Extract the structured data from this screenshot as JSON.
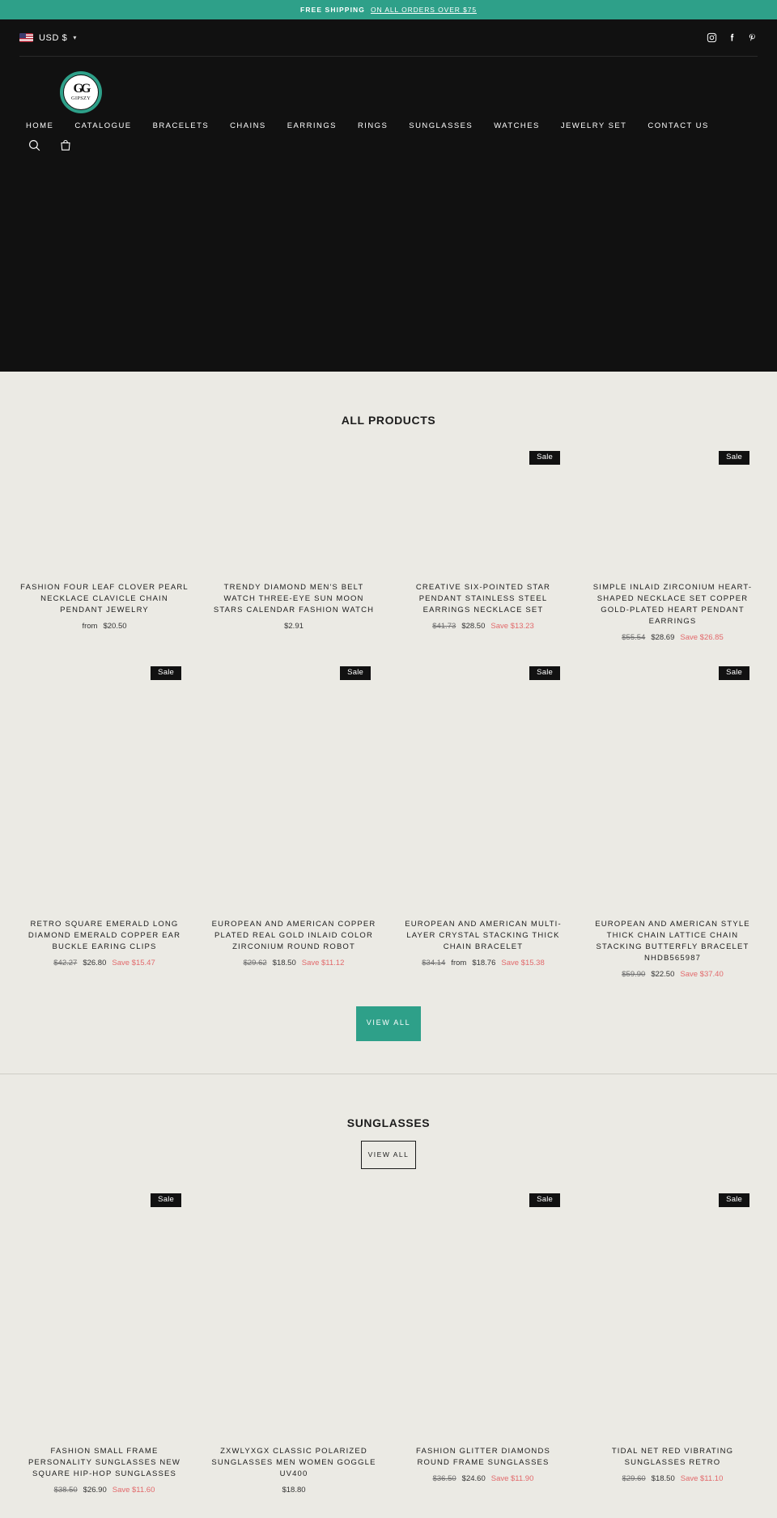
{
  "announcement": {
    "text": "FREE SHIPPING",
    "link_text": "ON ALL ORDERS OVER $75"
  },
  "header": {
    "currency": "USD $",
    "chevron": "⌄",
    "socials": [
      "instagram-icon",
      "facebook-icon",
      "pinterest-icon"
    ],
    "logo": {
      "monogram": "GG",
      "name": "GIPSZY"
    },
    "nav": [
      {
        "label": "HOME"
      },
      {
        "label": "CATALOGUE"
      },
      {
        "label": "BRACELETS"
      },
      {
        "label": "CHAINS"
      },
      {
        "label": "EARRINGS"
      },
      {
        "label": "RINGS"
      },
      {
        "label": "SUNGLASSES"
      },
      {
        "label": "WATCHES"
      },
      {
        "label": "JEWELRY SET"
      },
      {
        "label": "CONTACT US"
      }
    ],
    "icons": [
      "search-icon",
      "cart-icon"
    ]
  },
  "colors": {
    "accent": "#2ea089",
    "header_bg": "#111111",
    "page_bg": "#ebeae4",
    "sale_red": "#e2696b"
  },
  "all_products": {
    "title": "ALL PRODUCTS",
    "view_all": "VIEW ALL",
    "items": [
      {
        "badge": "",
        "title": "FASHION FOUR LEAF CLOVER PEARL NECKLACE CLAVICLE CHAIN PENDANT JEWELRY",
        "price_prefix": "from",
        "price": "$20.50",
        "was": "",
        "save": ""
      },
      {
        "badge": "",
        "title": "TRENDY DIAMOND MEN'S BELT WATCH THREE-EYE SUN MOON STARS CALENDAR FASHION WATCH",
        "price_prefix": "",
        "price": "$2.91",
        "was": "",
        "save": ""
      },
      {
        "badge": "Sale",
        "title": "CREATIVE SIX-POINTED STAR PENDANT STAINLESS STEEL EARRINGS NECKLACE SET",
        "price_prefix": "",
        "price": "$28.50",
        "was": "$41.73",
        "save": "Save $13.23"
      },
      {
        "badge": "Sale",
        "title": "SIMPLE INLAID ZIRCONIUM HEART-SHAPED NECKLACE SET COPPER GOLD-PLATED HEART PENDANT EARRINGS",
        "price_prefix": "",
        "price": "$28.69",
        "was": "$55.54",
        "save": "Save $26.85"
      },
      {
        "badge": "Sale",
        "title": "RETRO SQUARE EMERALD LONG DIAMOND EMERALD COPPER EAR BUCKLE EARING CLIPS",
        "price_prefix": "",
        "price": "$26.80",
        "was": "$42.27",
        "save": "Save $15.47"
      },
      {
        "badge": "Sale",
        "title": "EUROPEAN AND AMERICAN COPPER PLATED REAL GOLD INLAID COLOR ZIRCONIUM ROUND ROBOT",
        "price_prefix": "",
        "price": "$18.50",
        "was": "$29.62",
        "save": "Save $11.12"
      },
      {
        "badge": "Sale",
        "title": "EUROPEAN AND AMERICAN MULTI-LAYER CRYSTAL STACKING THICK CHAIN BRACELET",
        "price_prefix": "from",
        "price": "$18.76",
        "was": "$34.14",
        "save": "Save $15.38"
      },
      {
        "badge": "Sale",
        "title": "EUROPEAN AND AMERICAN STYLE THICK CHAIN LATTICE CHAIN STACKING BUTTERFLY BRACELET NHDB565987",
        "price_prefix": "",
        "price": "$22.50",
        "was": "$59.90",
        "save": "Save $37.40"
      }
    ]
  },
  "sunglasses": {
    "title": "SUNGLASSES",
    "view_all": "VIEW ALL",
    "items": [
      {
        "badge": "Sale",
        "title": "FASHION SMALL FRAME PERSONALITY SUNGLASSES NEW SQUARE HIP-HOP SUNGLASSES",
        "price_prefix": "",
        "price": "$26.90",
        "was": "$38.50",
        "save": "Save $11.60"
      },
      {
        "badge": "",
        "title": "ZXWLYXGX CLASSIC POLARIZED SUNGLASSES MEN WOMEN GOGGLE UV400",
        "price_prefix": "",
        "price": "$18.80",
        "was": "",
        "save": ""
      },
      {
        "badge": "Sale",
        "title": "FASHION GLITTER DIAMONDS ROUND FRAME SUNGLASSES",
        "price_prefix": "",
        "price": "$24.60",
        "was": "$36.50",
        "save": "Save $11.90"
      },
      {
        "badge": "Sale",
        "title": "TIDAL NET RED VIBRATING SUNGLASSES RETRO",
        "price_prefix": "",
        "price": "$18.50",
        "was": "$29.60",
        "save": "Save $11.10"
      }
    ]
  }
}
